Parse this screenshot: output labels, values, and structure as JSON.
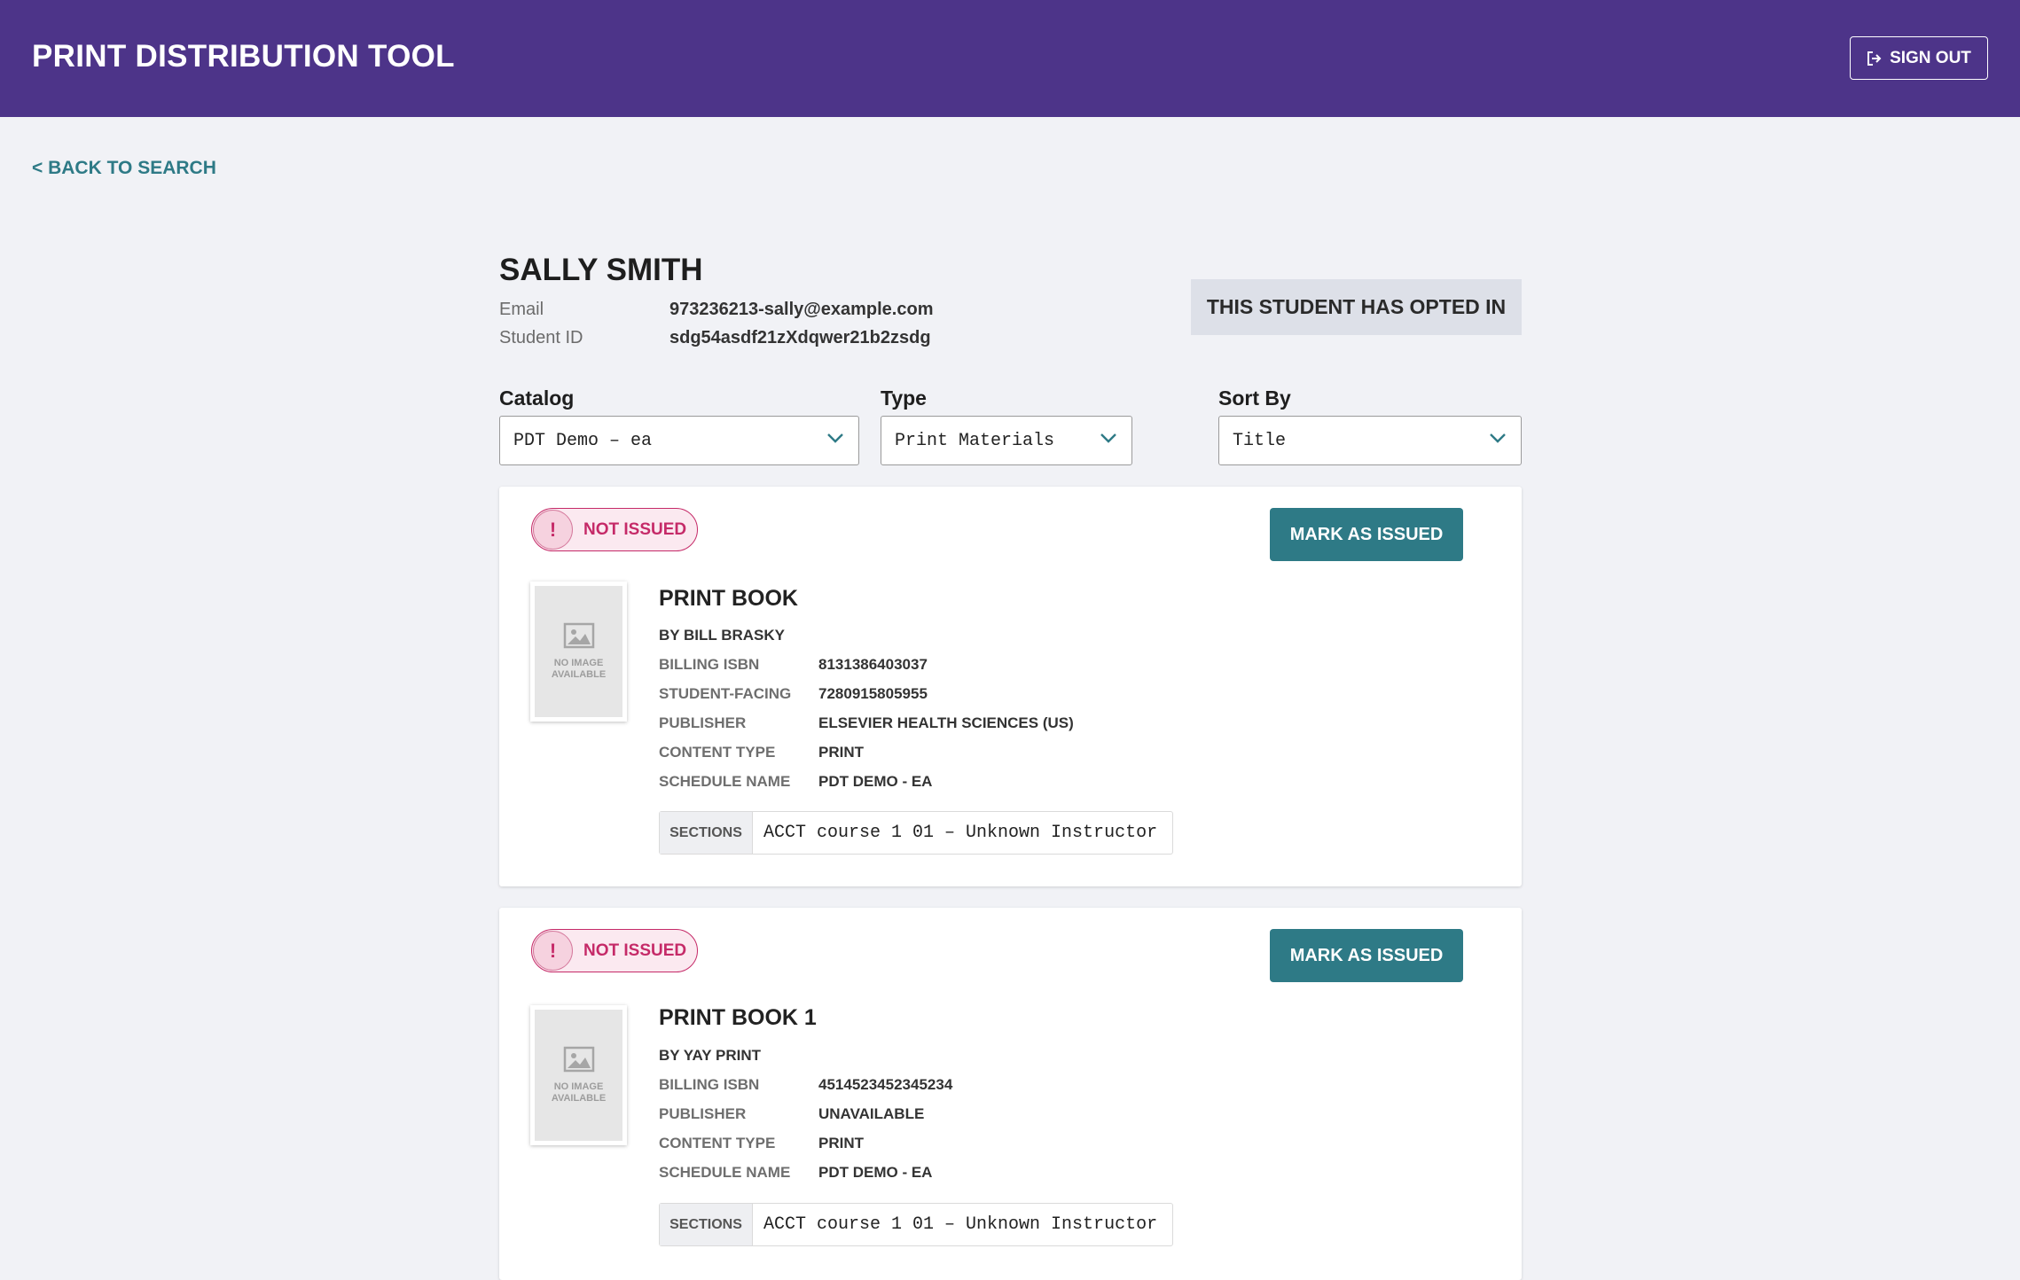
{
  "app": {
    "title": "PRINT DISTRIBUTION TOOL",
    "sign_out_label": "SIGN OUT",
    "back_label": "< BACK TO SEARCH"
  },
  "student": {
    "name": "SALLY SMITH",
    "email_label": "Email",
    "email": "973236213-sally@example.com",
    "id_label": "Student ID",
    "id": "sdg54asdf21zXdqwer21b2zsdg",
    "opt_status": "THIS STUDENT HAS OPTED IN"
  },
  "filters": {
    "catalog": {
      "label": "Catalog",
      "value": "PDT Demo – ea"
    },
    "type": {
      "label": "Type",
      "value": "Print Materials"
    },
    "sort": {
      "label": "Sort By",
      "value": "Title"
    }
  },
  "colors": {
    "header": "#4d3489",
    "accent": "#2e7a86",
    "not_issued": "#c52a68"
  },
  "items": [
    {
      "status": "NOT ISSUED",
      "action": "MARK AS ISSUED",
      "no_image": "NO IMAGE AVAILABLE",
      "title": "PRINT BOOK",
      "author": "BY BILL BRASKY",
      "details": [
        {
          "label": "BILLING ISBN",
          "value": "8131386403037"
        },
        {
          "label": "STUDENT-FACING",
          "value": "7280915805955"
        },
        {
          "label": "PUBLISHER",
          "value": "ELSEVIER HEALTH SCIENCES (US)"
        },
        {
          "label": "CONTENT TYPE",
          "value": "PRINT"
        },
        {
          "label": "SCHEDULE NAME",
          "value": "PDT DEMO - EA"
        }
      ],
      "sections_label": "SECTIONS",
      "sections_value": "ACCT course 1 01 – Unknown Instructor"
    },
    {
      "status": "NOT ISSUED",
      "action": "MARK AS ISSUED",
      "no_image": "NO IMAGE AVAILABLE",
      "title": "PRINT BOOK 1",
      "author": "BY YAY PRINT",
      "details": [
        {
          "label": "BILLING ISBN",
          "value": "4514523452345234"
        },
        {
          "label": "PUBLISHER",
          "value": "UNAVAILABLE"
        },
        {
          "label": "CONTENT TYPE",
          "value": "PRINT"
        },
        {
          "label": "SCHEDULE NAME",
          "value": "PDT DEMO - EA"
        }
      ],
      "sections_label": "SECTIONS",
      "sections_value": "ACCT course 1 01 – Unknown Instructor"
    }
  ]
}
